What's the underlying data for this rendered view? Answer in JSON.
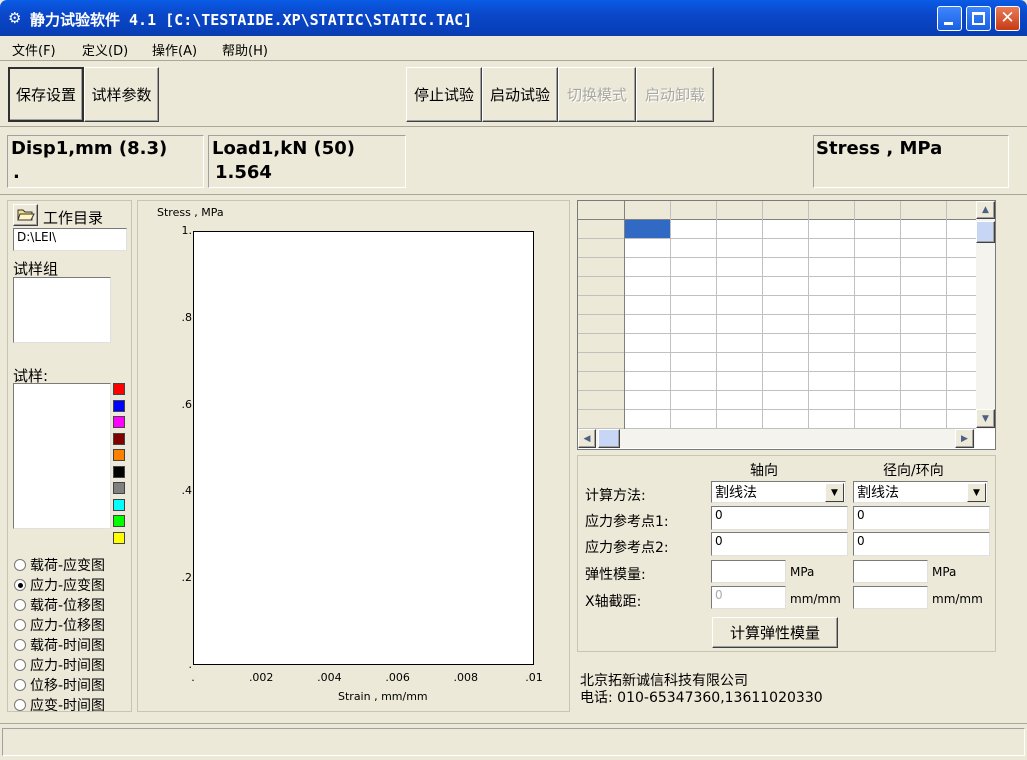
{
  "window": {
    "title": "静力试验软件 4.1 [C:\\TESTAIDE.XP\\STATIC\\STATIC.TAC]"
  },
  "menu": [
    "文件(F)",
    "定义(D)",
    "操作(A)",
    "帮助(H)"
  ],
  "toolbar": {
    "save_settings": "保存设置",
    "specimen_params": "试样参数",
    "stop_test": "停止试验",
    "start_test": "启动试验",
    "switch_mode": "切换模式",
    "start_unload": "启动卸载"
  },
  "readouts": {
    "disp_label": "Disp1,mm (8.3)",
    "disp_value": ".",
    "load_label": "Load1,kN (50)",
    "load_value": "1.564",
    "stress_label": "Stress , MPa"
  },
  "left_panel": {
    "work_dir_label": "工作目录",
    "work_dir_value": "D:\\LEI\\",
    "specimen_group_label": "试样组",
    "specimen_label": "试样:",
    "swatch_colors": [
      "#ff0000",
      "#0000ff",
      "#ff00ff",
      "#800000",
      "#ff8000",
      "#000000",
      "#808080",
      "#00ffff",
      "#00ff00",
      "#ffff00"
    ],
    "plot_options": [
      "载荷-应变图",
      "应力-应变图",
      "载荷-位移图",
      "应力-位移图",
      "载荷-时间图",
      "应力-时间图",
      "位移-时间图",
      "应变-时间图"
    ],
    "selected_option": 1
  },
  "chart": {
    "ylabel": "Stress , MPa",
    "xlabel": "Strain , mm/mm",
    "yticks": [
      "1.",
      ".8",
      ".6",
      ".4",
      ".2",
      "."
    ],
    "xticks": [
      ".",
      ".002",
      ".004",
      ".006",
      ".008",
      ".01"
    ]
  },
  "chart_data": {
    "type": "line",
    "xlabel": "Strain , mm/mm",
    "ylabel": "Stress , MPa",
    "xlim": [
      0,
      0.01
    ],
    "ylim": [
      0,
      1
    ],
    "series": []
  },
  "calc": {
    "col_axial": "轴向",
    "col_radial": "径向/环向",
    "method_label": "计算方法:",
    "method_axial": "割线法",
    "method_radial": "割线法",
    "ref1_label": "应力参考点1:",
    "ref1_axial": "0",
    "ref1_radial": "0",
    "ref2_label": "应力参考点2:",
    "ref2_axial": "0",
    "ref2_radial": "0",
    "modulus_label": "弹性模量:",
    "modulus_unit": "MPa",
    "intercept_label": "X轴截距:",
    "intercept_axial": "0",
    "intercept_unit": "mm/mm",
    "calc_button": "计算弹性模量"
  },
  "footer": {
    "company": "北京拓新诚信科技有限公司",
    "phone": "电话: 010-65347360,13611020330"
  }
}
